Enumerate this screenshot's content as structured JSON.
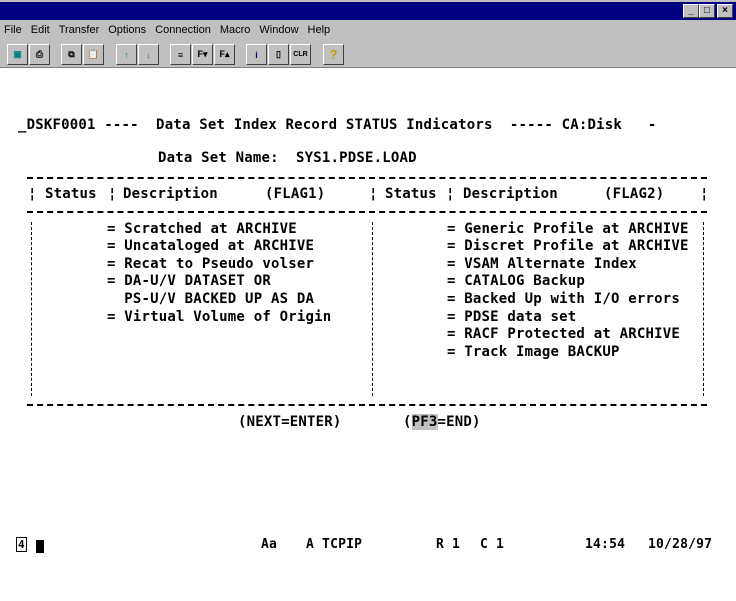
{
  "window": {
    "controls": [
      "_",
      "□",
      "×"
    ]
  },
  "menu": [
    "File",
    "Edit",
    "Transfer",
    "Options",
    "Connection",
    "Macro",
    "Window",
    "Help"
  ],
  "toolbar": [
    {
      "icon": "display-icon",
      "glyph": "▣"
    },
    {
      "icon": "print-icon",
      "glyph": "⎙"
    },
    {
      "icon": "copy-icon",
      "glyph": "⧉"
    },
    {
      "icon": "paste-icon",
      "glyph": "📋"
    },
    {
      "icon": "send-file-icon",
      "glyph": "↑"
    },
    {
      "icon": "receive-file-icon",
      "glyph": "↓"
    },
    {
      "icon": "keyboard-map-icon",
      "glyph": "≡"
    },
    {
      "icon": "font-down-icon",
      "glyph": "F▾"
    },
    {
      "icon": "font-up-icon",
      "glyph": "F▴"
    },
    {
      "icon": "info-icon",
      "glyph": "i"
    },
    {
      "icon": "macro-icon",
      "glyph": "▯"
    },
    {
      "icon": "clear-icon",
      "glyph": "CLR"
    },
    {
      "icon": "help-icon",
      "glyph": "?"
    }
  ],
  "screen": {
    "header": "_DSKF0001 ----  Data Set Index Record STATUS Indicators  ----- CA:Disk   -",
    "dataset_label": "Data Set Name:",
    "dataset_value": "SYS1.PDSE.LOAD",
    "columns": {
      "status": "Status",
      "description": "Description",
      "flag1": "(FLAG1)",
      "flag2": "(FLAG2)",
      "sep": "¦"
    },
    "flag1_items": [
      "= Scratched at ARCHIVE",
      "= Uncataloged at ARCHIVE",
      "= Recat to Pseudo volser",
      "= DA-U/V DATASET OR",
      "  PS-U/V BACKED UP AS DA",
      "= Virtual Volume of Origin"
    ],
    "flag2_items": [
      "= Generic Profile at ARCHIVE",
      "= Discret Profile at ARCHIVE",
      "= VSAM Alternate Index",
      "= CATALOG Backup",
      "= Backed Up with I/O errors",
      "= PDSE data set",
      "= RACF Protected at ARCHIVE",
      "= Track Image BACKUP"
    ],
    "next": "(NEXT=ENTER)",
    "end_open": "(",
    "end_key": "PF3",
    "end_rest": "=END)"
  },
  "status": {
    "session": "4",
    "mode": "Aa",
    "conn": "A TCPIP",
    "row": "R 1",
    "col": "C 1",
    "time": "14:54",
    "date": "10/28/97"
  }
}
